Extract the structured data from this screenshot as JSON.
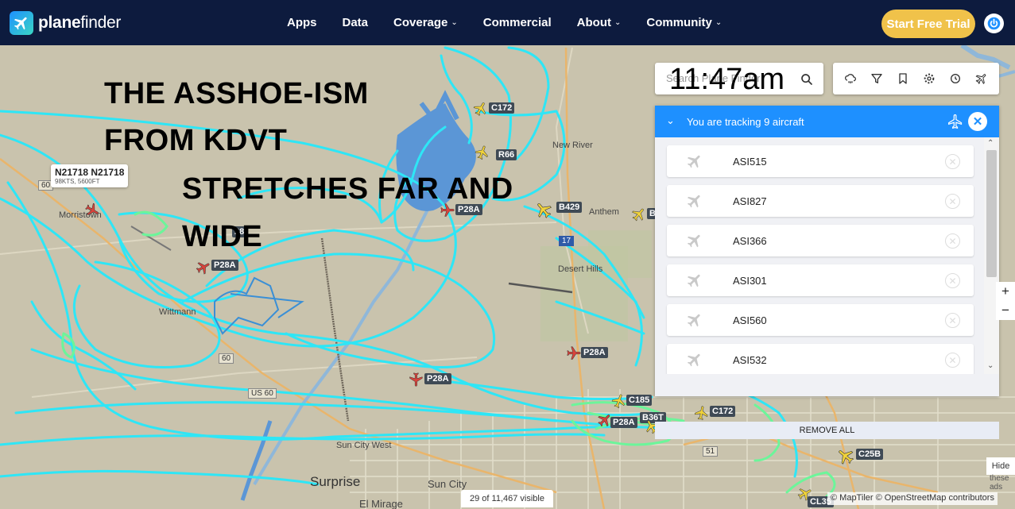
{
  "header": {
    "logo_bold": "plane",
    "logo_light": "finder",
    "nav": [
      {
        "label": "Apps",
        "chevron": ""
      },
      {
        "label": "Data",
        "chevron": ""
      },
      {
        "label": "Coverage",
        "chevron": "⌄"
      },
      {
        "label": "Commercial",
        "chevron": ""
      },
      {
        "label": "About",
        "chevron": "⌄"
      },
      {
        "label": "Community",
        "chevron": "⌄"
      }
    ],
    "trial_button": "Start Free Trial"
  },
  "overlay": {
    "line1": "THE ASSHOE-ISM",
    "line2": "FROM KDVT",
    "line3": "STRETCHES FAR AND",
    "line4": "WIDE"
  },
  "search": {
    "placeholder": "Search Plane Finder",
    "clock": "11:47am"
  },
  "callout": {
    "title": "N21718 N21718",
    "detail": "98KTS, 5600FT"
  },
  "places": {
    "morristown": "Morristown",
    "wittmann": "Wittmann",
    "new_river": "New River",
    "anthem": "Anthem",
    "desert_hills": "Desert Hills",
    "surprise": "Surprise",
    "sun_city": "Sun City",
    "sun_city_west": "Sun City West",
    "el_mirage": "El Mirage"
  },
  "highways": {
    "us60a": "60",
    "us60b": "60",
    "us60_label": "US 60",
    "i17": "17",
    "rt51": "51"
  },
  "aircraft_tags": {
    "c172a": "C172",
    "r66": "R66",
    "p28a_lake": "P28A",
    "b429": "B429",
    "b_partial": "B",
    "p28a_west": "P28A",
    "p28_partial": "28",
    "p28a_mid": "P28A",
    "p28a_center": "P28A",
    "c185": "C185",
    "b36t": "B36T",
    "p28a_kdvt": "P28A",
    "c172b": "C172",
    "c25b": "C25B",
    "cl35": "CL35"
  },
  "panel": {
    "title": "You are tracking 9 aircraft",
    "aircraft": [
      {
        "callsign": "ASI515"
      },
      {
        "callsign": "ASI827"
      },
      {
        "callsign": "ASI366"
      },
      {
        "callsign": "ASI301"
      },
      {
        "callsign": "ASI560"
      },
      {
        "callsign": "ASI532"
      }
    ],
    "remove_all": "REMOVE ALL"
  },
  "zoom": {
    "in": "+",
    "out": "−"
  },
  "footer": {
    "visible_count": "29 of 11,467 visible",
    "hide_ads": "Hide",
    "ads_text": "these ads",
    "attribution": "© MapTiler © OpenStreetMap contributors"
  },
  "colors": {
    "nav_bg": "#0d1b3e",
    "accent": "#1e90ff",
    "trial": "#f0c24a",
    "track_cyan": "#2ee6f6",
    "track_green": "#6cf59a",
    "plane_red": "#d9433b",
    "plane_yellow": "#f0d23a"
  }
}
